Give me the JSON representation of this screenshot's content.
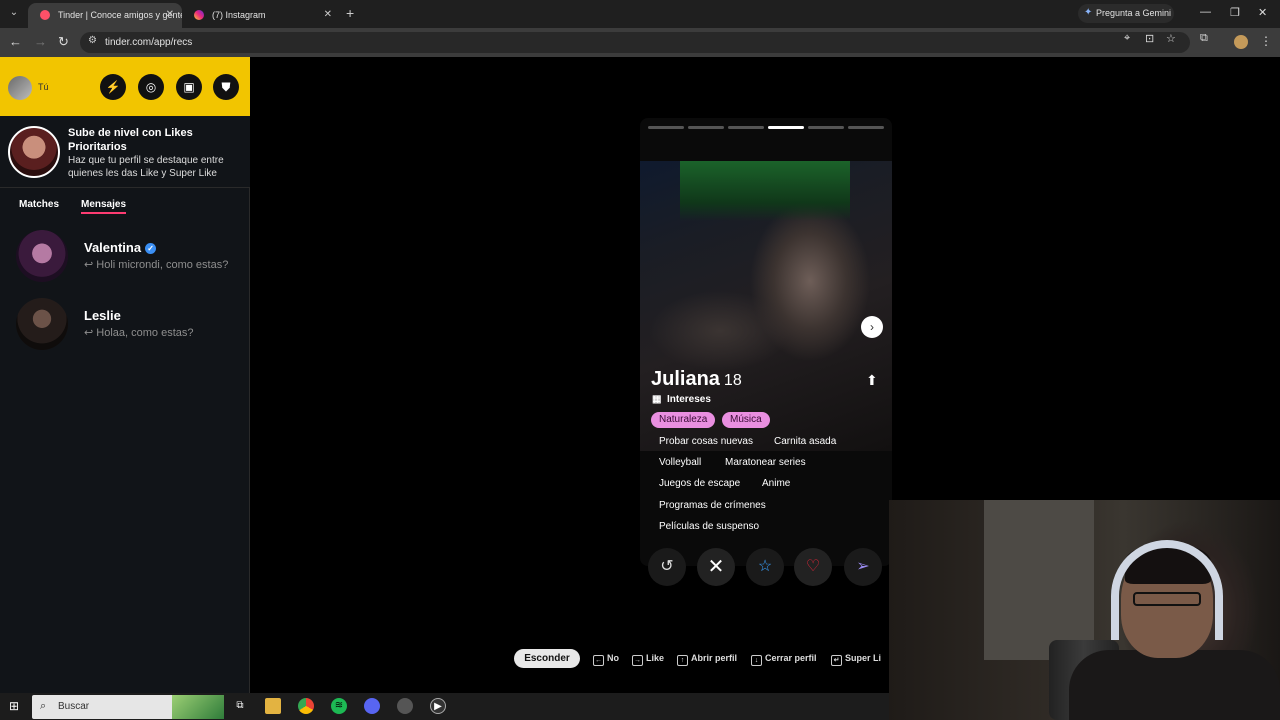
{
  "browser": {
    "tabs": [
      {
        "title": "Tinder | Conoce amigos y gente",
        "active": true
      },
      {
        "title": "(7) Instagram",
        "active": false
      }
    ],
    "gemini_label": "Pregunta a Gemini",
    "url": "tinder.com/app/recs"
  },
  "sidebar": {
    "me_label": "Tú",
    "header_buttons": [
      "boost-icon",
      "explore-icon",
      "briefcase-icon",
      "shield-icon"
    ],
    "promo": {
      "title": "Sube de nivel con Likes Prioritarios",
      "subtitle": "Haz que tu perfil se destaque entre quienes les das Like y Super Like"
    },
    "tabs": [
      "Matches",
      "Mensajes"
    ],
    "active_tab": "Mensajes",
    "conversations": [
      {
        "name": "Valentina",
        "verified": true,
        "message": "↩ Holi microndi, como estas?"
      },
      {
        "name": "Leslie",
        "verified": false,
        "message": "↩ Holaa, como estas?"
      }
    ]
  },
  "card": {
    "photo_count": 6,
    "current_photo": 4,
    "name": "Juliana",
    "age": "18",
    "interests_label": "Intereses",
    "highlighted_interests": [
      "Naturaleza",
      "Música"
    ],
    "interests": [
      [
        "Probar cosas nuevas",
        "Carnita asada"
      ],
      [
        "Volleyball",
        "Maratonear series"
      ],
      [
        "Juegos de escape",
        "Anime"
      ],
      [
        "Programas de crímenes"
      ],
      [
        "Películas de suspenso"
      ]
    ],
    "actions": [
      "rewind-icon",
      "nope-icon",
      "super-like-icon",
      "like-icon",
      "boost-icon"
    ]
  },
  "hints": {
    "hide_button": "Esconder",
    "items": [
      "No",
      "Like",
      "Abrir perfil",
      "Cerrar perfil",
      "Super Li"
    ]
  },
  "taskbar": {
    "search_placeholder": "Buscar"
  },
  "colors": {
    "tinder_yellow": "#f2c500",
    "tinder_pink": "#fe3c72",
    "chip_pink": "#e98fe0",
    "like_red": "#e8273b"
  }
}
